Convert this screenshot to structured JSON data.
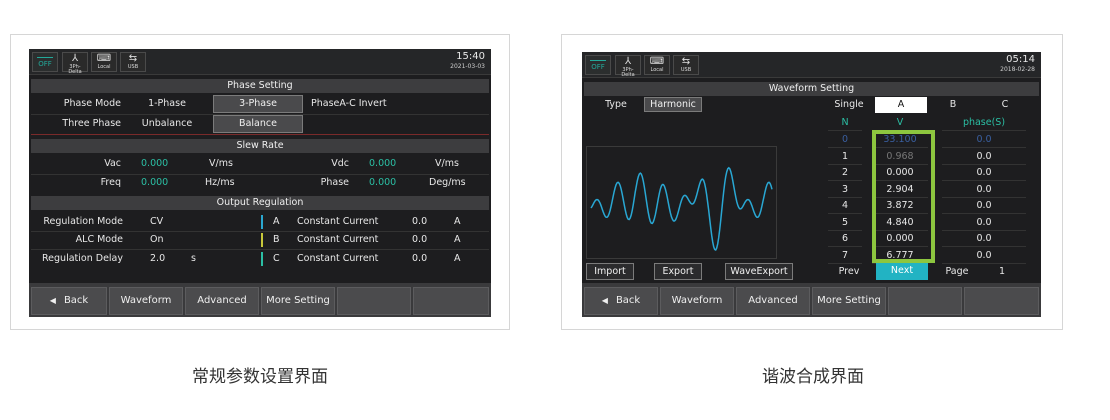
{
  "left": {
    "status": {
      "off": "OFF",
      "icons": [
        {
          "name": "3ph-delta-icon",
          "glyph": "⅄",
          "label": "3Ph-Delta"
        },
        {
          "name": "local-icon",
          "glyph": "⌨",
          "label": "Local"
        },
        {
          "name": "usb-icon",
          "glyph": "⇆",
          "label": "USB"
        }
      ],
      "time": "15:40",
      "date": "2021-03-03"
    },
    "phase_setting": {
      "header": "Phase Setting",
      "phase_mode_label": "Phase Mode",
      "opt_1phase": "1-Phase",
      "opt_3phase": "3-Phase",
      "invert": "PhaseA-C Invert",
      "three_phase_label": "Three Phase",
      "opt_unbalance": "Unbalance",
      "opt_balance": "Balance"
    },
    "slew_rate": {
      "header": "Slew Rate",
      "vac_label": "Vac",
      "vac_value": "0.000",
      "vac_unit": "V/ms",
      "vdc_label": "Vdc",
      "vdc_value": "0.000",
      "vdc_unit": "V/ms",
      "freq_label": "Freq",
      "freq_value": "0.000",
      "freq_unit": "Hz/ms",
      "phase_label": "Phase",
      "phase_value": "0.000",
      "phase_unit": "Deg/ms"
    },
    "output_regulation": {
      "header": "Output Regulation",
      "rows": [
        {
          "label": "Regulation Mode",
          "value": "CV",
          "unit": "",
          "phase": "A",
          "mode": "Constant Current",
          "num": "0.0",
          "u2": "A",
          "color": "#2aa7d0"
        },
        {
          "label": "ALC Mode",
          "value": "On",
          "unit": "",
          "phase": "B",
          "mode": "Constant Current",
          "num": "0.0",
          "u2": "A",
          "color": "#c8c83a"
        },
        {
          "label": "Regulation Delay",
          "value": "2.0",
          "unit": "s",
          "phase": "C",
          "mode": "Constant Current",
          "num": "0.0",
          "u2": "A",
          "color": "#2bbfa4"
        }
      ]
    },
    "bottom": {
      "back": "Back",
      "waveform": "Waveform",
      "advanced": "Advanced",
      "more": "More Setting"
    },
    "caption": "常规参数设置界面"
  },
  "right": {
    "status": {
      "off": "OFF",
      "icons": [
        {
          "name": "3ph-delta-icon",
          "glyph": "⅄",
          "label": "3Ph-Delta"
        },
        {
          "name": "local-icon",
          "glyph": "⌨",
          "label": "Local"
        },
        {
          "name": "usb-icon",
          "glyph": "⇆",
          "label": "USB"
        }
      ],
      "time": "05:14",
      "date": "2018-02-28"
    },
    "header": "Waveform Setting",
    "type_label": "Type",
    "type_value": "Harmonic",
    "single_label": "Single",
    "tabs": [
      "A",
      "B",
      "C"
    ],
    "col_n": "N",
    "col_v": "V",
    "col_phase": "phase(S)",
    "harmonics": [
      {
        "n": "0",
        "v": "33.100",
        "p": "0.0"
      },
      {
        "n": "1",
        "v": "0.968",
        "p": "0.0"
      },
      {
        "n": "2",
        "v": "0.000",
        "p": "0.0"
      },
      {
        "n": "3",
        "v": "2.904",
        "p": "0.0"
      },
      {
        "n": "4",
        "v": "3.872",
        "p": "0.0"
      },
      {
        "n": "5",
        "v": "4.840",
        "p": "0.0"
      },
      {
        "n": "6",
        "v": "0.000",
        "p": "0.0"
      },
      {
        "n": "7",
        "v": "6.777",
        "p": "0.0"
      }
    ],
    "import": "Import",
    "export": "Export",
    "wave_export": "WaveExport",
    "prev": "Prev",
    "next": "Next",
    "page_label": "Page",
    "page_value": "1",
    "highlight_color": "#8dc63f",
    "bottom": {
      "back": "Back",
      "waveform": "Waveform",
      "advanced": "Advanced",
      "more": "More Setting"
    },
    "caption": "谐波合成界面"
  }
}
